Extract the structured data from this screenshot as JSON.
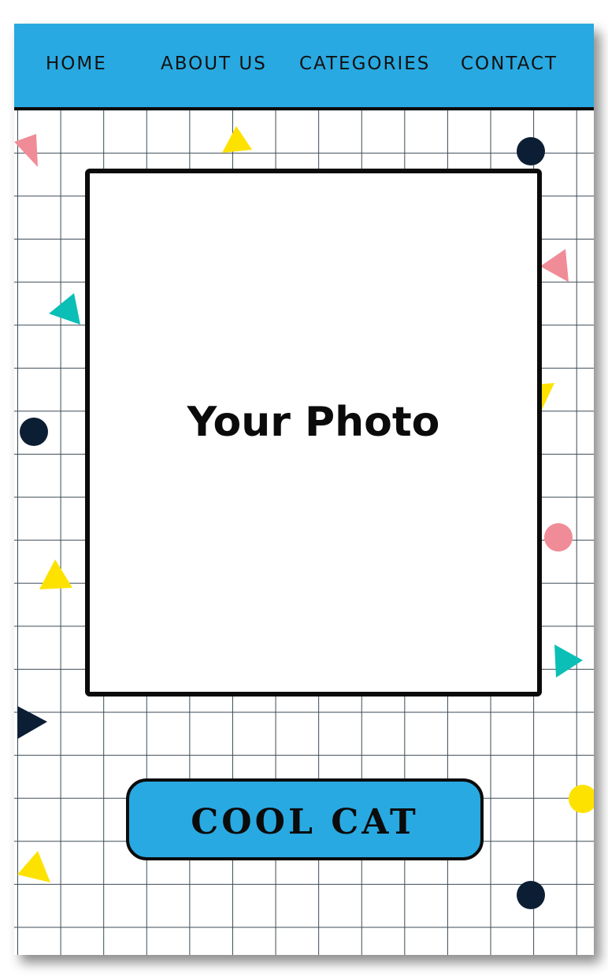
{
  "nav": {
    "items": [
      {
        "label": "HOME"
      },
      {
        "label": "ABOUT US"
      },
      {
        "label": "CATEGORIES"
      },
      {
        "label": "CONTACT"
      }
    ]
  },
  "photo": {
    "placeholder_label": "Your Photo"
  },
  "cta": {
    "label": "COOL CAT"
  },
  "colors": {
    "accent_blue": "#29a9e1",
    "pink": "#f08c97",
    "yellow": "#fde200",
    "teal": "#0bbfb7",
    "navy": "#0c1e33",
    "grid": "#3b4a55"
  }
}
